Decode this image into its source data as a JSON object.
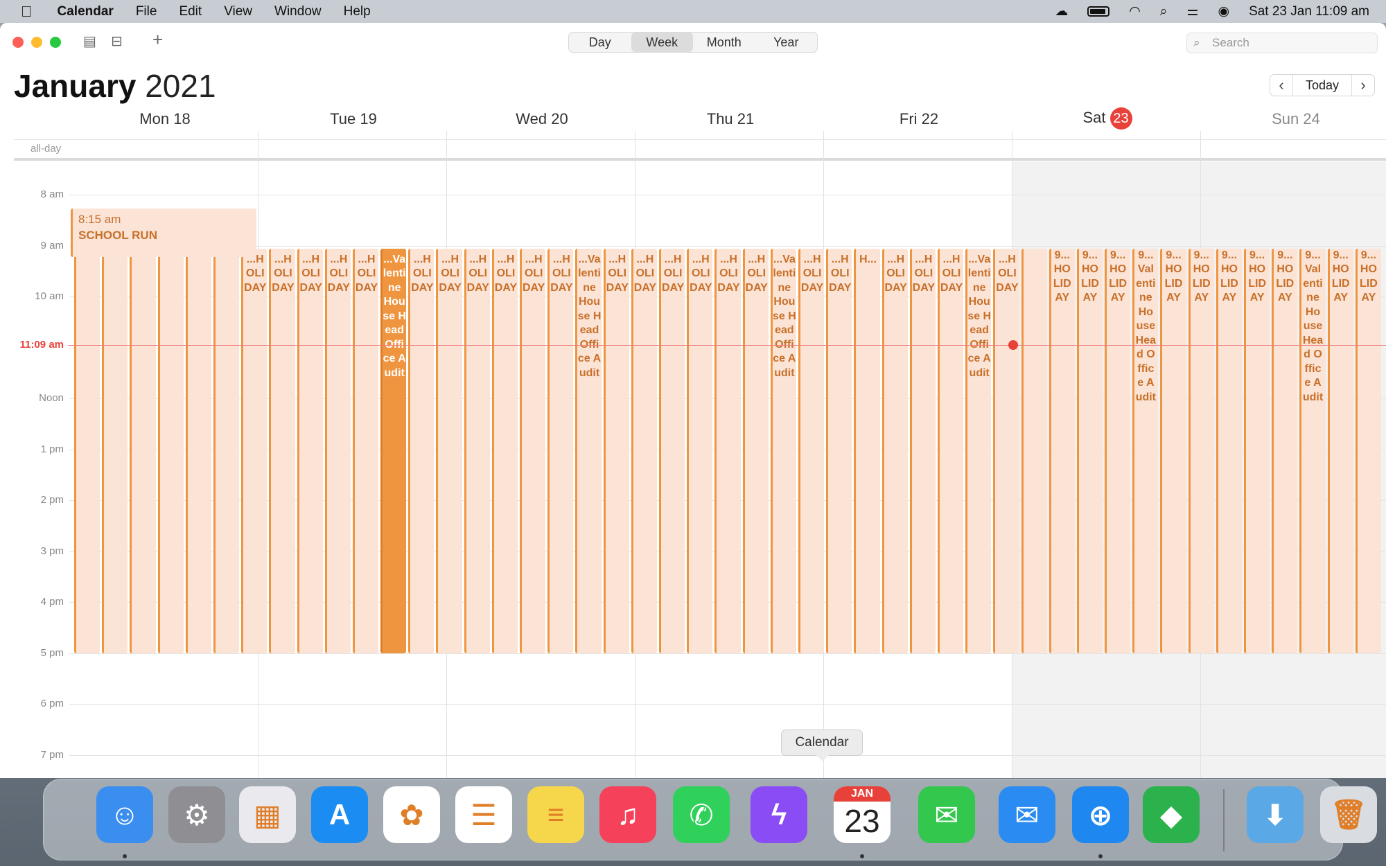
{
  "menubar": {
    "apple_icon": "apple-icon",
    "app_name": "Calendar",
    "menus": [
      "File",
      "Edit",
      "View",
      "Window",
      "Help"
    ],
    "clock": "Sat 23 Jan  11:09 am"
  },
  "toolbar": {
    "views": [
      "Day",
      "Week",
      "Month",
      "Year"
    ],
    "active_view": "Week",
    "search_placeholder": "Search",
    "today_label": "Today"
  },
  "header": {
    "month": "January",
    "year": "2021"
  },
  "days": [
    {
      "label": "Mon 18"
    },
    {
      "label": "Tue 19"
    },
    {
      "label": "Wed 20"
    },
    {
      "label": "Thu 21"
    },
    {
      "label": "Fri 22"
    },
    {
      "label": "Sat",
      "badge": "23"
    },
    {
      "label": "Sun 24"
    }
  ],
  "allday_label": "all-day",
  "hours": [
    "8 am",
    "9 am",
    "10 am",
    "",
    "Noon",
    "1 pm",
    "2 pm",
    "3 pm",
    "4 pm",
    "5 pm",
    "6 pm",
    "7 pm"
  ],
  "now_label": "11:09 am",
  "events": {
    "school_run": {
      "time": "8:15 am",
      "title": "SCHOOL RUN"
    },
    "columns": [
      "",
      "",
      "",
      "",
      "",
      "",
      "...HOLIDAY",
      "...HOLIDAY",
      "...HOLIDAY",
      "...HOLIDAY",
      "...HOLIDAY",
      "...Valentine House Head Office Audit",
      "...HOLIDAY",
      "...HOLIDAY",
      "...HOLIDAY",
      "...HOLIDAY",
      "...HOLIDAY",
      "...HOLIDAY",
      "...Valentine House Head Office Audit",
      "...HOLIDAY",
      "...HOLIDAY",
      "...HOLIDAY",
      "...HOLIDAY",
      "...HOLIDAY",
      "...HOLIDAY",
      "...Valentine House Head Office Audit",
      "...HOLIDAY",
      "...HOLIDAY",
      "H...",
      "...HOLIDAY",
      "...HOLIDAY",
      "...HOLIDAY",
      "...Valentine House Head Office Audit",
      "...HOLIDAY",
      "",
      "9...HOLIDAY",
      "9...HOLIDAY",
      "9...HOLIDAY",
      "9...Valentine House Head Office Audit",
      "9...HOLIDAY",
      "9...HOLIDAY",
      "9...HOLIDAY",
      "9...HOLIDAY",
      "9...HOLIDAY",
      "9...Valentine House Head Office Audit",
      "9...HOLIDAY",
      "9...HOLIDAY"
    ],
    "highlighted_index": 11
  },
  "tooltip": "Calendar",
  "dock": {
    "apps": [
      {
        "name": "Finder",
        "icon": "finder-icon",
        "color": "#3a8ef0",
        "glyph": "☺"
      },
      {
        "name": "System Preferences",
        "icon": "gear-icon",
        "color": "#8e8e93",
        "glyph": "⚙"
      },
      {
        "name": "Launchpad",
        "icon": "launchpad-icon",
        "color": "#e9e9ee",
        "glyph": "▦"
      },
      {
        "name": "App Store",
        "icon": "app-store-icon",
        "color": "#1b8cf2",
        "glyph": "A"
      },
      {
        "name": "Photos",
        "icon": "photos-icon",
        "color": "#ffffff",
        "glyph": "✿"
      },
      {
        "name": "Reminders",
        "icon": "reminders-icon",
        "color": "#ffffff",
        "glyph": "☰"
      },
      {
        "name": "Notes",
        "icon": "notes-icon",
        "color": "#f6d64a",
        "glyph": "≡"
      },
      {
        "name": "Music",
        "icon": "music-icon",
        "color": "#f5425a",
        "glyph": "♫"
      },
      {
        "name": "WhatsApp",
        "icon": "whatsapp-icon",
        "color": "#2fd15a",
        "glyph": "✆"
      },
      {
        "name": "Messenger",
        "icon": "messenger-icon",
        "color": "#8a4cf5",
        "glyph": "ϟ"
      },
      {
        "name": "Calendar",
        "icon": "calendar-icon",
        "color": "#ffffff",
        "month": "JAN",
        "day": "23"
      },
      {
        "name": "Messages",
        "icon": "messages-icon",
        "color": "#33c74e",
        "glyph": "✉"
      },
      {
        "name": "Mail",
        "icon": "mail-icon",
        "color": "#2a8bf2",
        "glyph": "✉"
      },
      {
        "name": "Safari",
        "icon": "safari-icon",
        "color": "#1e88f0",
        "glyph": "⊕"
      },
      {
        "name": "Feedly",
        "icon": "feedly-icon",
        "color": "#2bb24c",
        "glyph": "◆"
      },
      {
        "name": "Downloads",
        "icon": "downloads-folder-icon",
        "color": "#5aa8e6",
        "glyph": "⬇"
      },
      {
        "name": "Trash",
        "icon": "trash-icon",
        "color": "#d9dde2",
        "glyph": "🗑"
      }
    ]
  }
}
